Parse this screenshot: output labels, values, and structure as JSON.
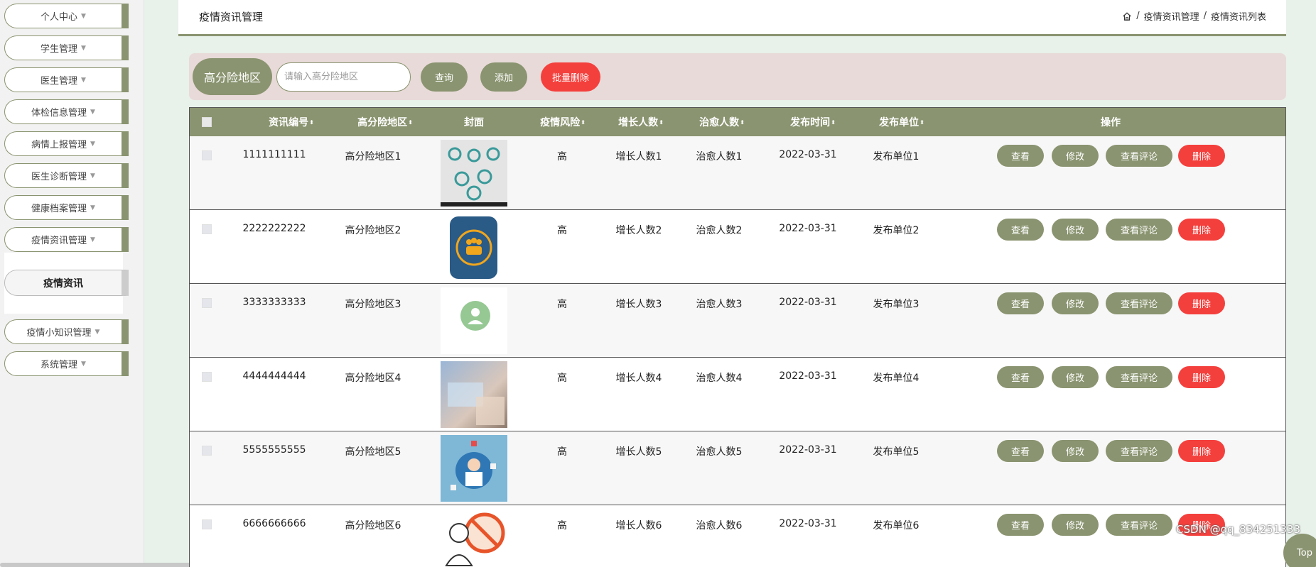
{
  "sidebar": {
    "items": [
      {
        "label": "个人中心"
      },
      {
        "label": "学生管理"
      },
      {
        "label": "医生管理"
      },
      {
        "label": "体检信息管理"
      },
      {
        "label": "病情上报管理"
      },
      {
        "label": "医生诊断管理"
      },
      {
        "label": "健康档案管理"
      },
      {
        "label": "疫情资讯管理"
      },
      {
        "label": "疫情小知识管理"
      },
      {
        "label": "系统管理"
      }
    ],
    "active_sub": "疫情资讯",
    "caret": "▼"
  },
  "header": {
    "title": "疫情资讯管理",
    "breadcrumb": [
      "疫情资讯管理",
      "疫情资讯列表"
    ],
    "sep": "/"
  },
  "search": {
    "label": "高分险地区",
    "placeholder": "请输入高分险地区",
    "query": "查询",
    "add": "添加",
    "batch_delete": "批量删除"
  },
  "table": {
    "columns": {
      "id": "资讯编号",
      "area": "高分险地区",
      "cover": "封面",
      "risk": "疫情风险",
      "growth": "增长人数",
      "cured": "治愈人数",
      "date": "发布时间",
      "unit": "发布单位",
      "ops": "操作"
    },
    "sort_icon": "⬍",
    "actions": {
      "view": "查看",
      "edit": "修改",
      "comment": "查看评论",
      "delete": "删除"
    },
    "rows": [
      {
        "id": "1111111111",
        "area": "高分险地区1",
        "risk": "高",
        "growth": "增长人数1",
        "cured": "治愈人数1",
        "date": "2022-03-31",
        "unit": "发布单位1"
      },
      {
        "id": "2222222222",
        "area": "高分险地区2",
        "risk": "高",
        "growth": "增长人数2",
        "cured": "治愈人数2",
        "date": "2022-03-31",
        "unit": "发布单位2"
      },
      {
        "id": "3333333333",
        "area": "高分险地区3",
        "risk": "高",
        "growth": "增长人数3",
        "cured": "治愈人数3",
        "date": "2022-03-31",
        "unit": "发布单位3"
      },
      {
        "id": "4444444444",
        "area": "高分险地区4",
        "risk": "高",
        "growth": "增长人数4",
        "cured": "治愈人数4",
        "date": "2022-03-31",
        "unit": "发布单位4"
      },
      {
        "id": "5555555555",
        "area": "高分险地区5",
        "risk": "高",
        "growth": "增长人数5",
        "cured": "治愈人数5",
        "date": "2022-03-31",
        "unit": "发布单位5"
      },
      {
        "id": "6666666666",
        "area": "高分险地区6",
        "risk": "高",
        "growth": "增长人数6",
        "cured": "治愈人数6",
        "date": "2022-03-31",
        "unit": "发布单位6"
      }
    ]
  },
  "watermark": "CSDN @qq_834251333",
  "top_button": "Top",
  "colors": {
    "accent": "#8a9470",
    "danger": "#f4403d",
    "search_bg": "#e8dad8",
    "page_bg": "#e8f1ea"
  }
}
